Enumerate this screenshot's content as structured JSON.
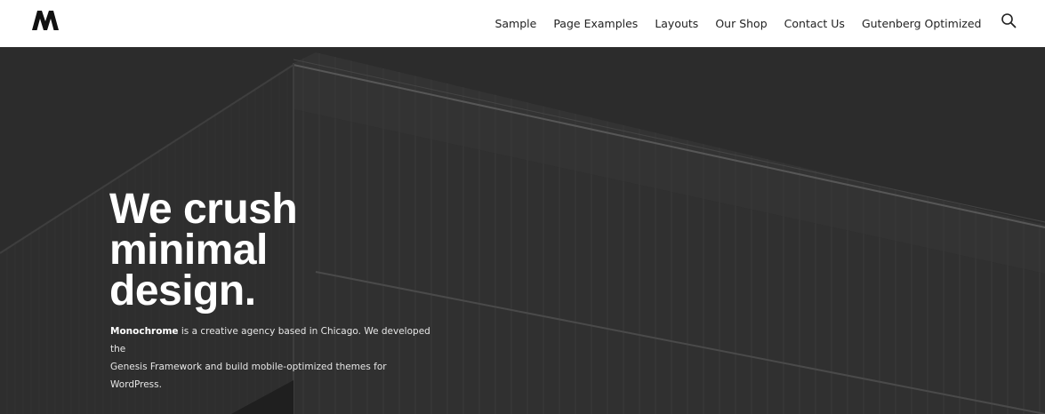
{
  "brand": {
    "logo_icon": "monochrome-m-logo"
  },
  "nav": {
    "items": [
      {
        "label": "Sample"
      },
      {
        "label": "Page Examples"
      },
      {
        "label": "Layouts"
      },
      {
        "label": "Our Shop"
      },
      {
        "label": "Contact Us"
      },
      {
        "label": "Gutenberg Optimized"
      }
    ],
    "search_icon": "search-icon"
  },
  "hero": {
    "headline": [
      "We crush",
      "minimal",
      "design."
    ],
    "intro_brand": "Monochrome",
    "intro_text_1": " is a creative agency based in Chicago. We developed the",
    "intro_text_2": "Genesis Framework and build mobile-optimized themes for WordPress.",
    "background_color": "#2f2f2f"
  }
}
